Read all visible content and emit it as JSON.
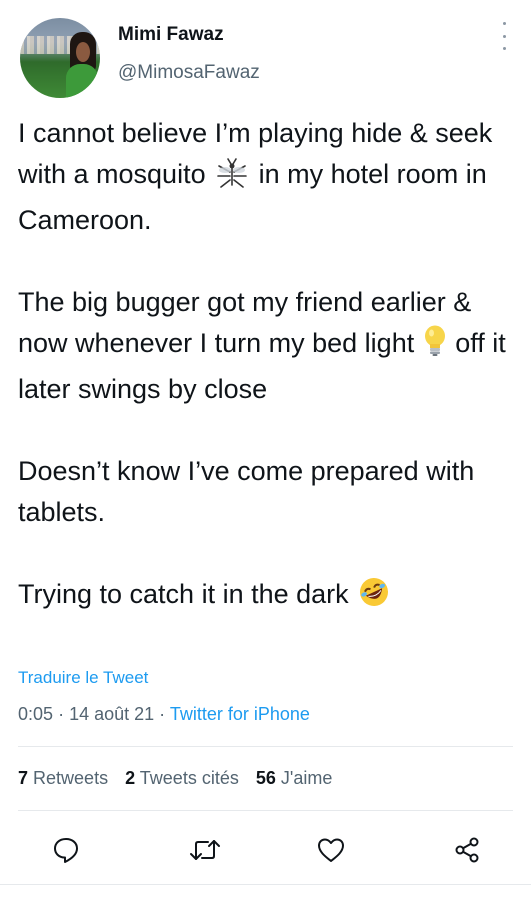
{
  "author": {
    "name": "Mimi Fawaz",
    "handle": "@MimosaFawaz"
  },
  "tweet": {
    "p1_a": "I cannot believe I’m playing hide & seek with a mosquito",
    "p1_b": "in my hotel room in Cameroon.",
    "p2_a": "The big bugger got my friend earlier & now whenever I turn my bed light",
    "p2_b": "off it later swings by close",
    "p3": "Doesn’t know I’ve come prepared with tablets.",
    "p4": "Trying to catch it in the dark"
  },
  "emojis": {
    "mosquito": "mosquito-emoji",
    "bulb": "light-bulb-emoji",
    "laugh": "rolling-on-floor-laughing-emoji"
  },
  "translate_label": "Traduire le Tweet",
  "meta": {
    "time": "0:05",
    "date": "14 août 21",
    "separator": "·",
    "source": "Twitter for iPhone"
  },
  "stats": {
    "retweets_count": "7",
    "retweets_label": "Retweets",
    "quotes_count": "2",
    "quotes_label": "Tweets cités",
    "likes_count": "56",
    "likes_label": "J'aime"
  },
  "actions": [
    "reply-icon",
    "retweet-icon",
    "like-icon",
    "share-icon"
  ],
  "colors": {
    "link": "#1d9bf0",
    "secondary_text": "#536471",
    "primary_text": "#0f1419"
  }
}
